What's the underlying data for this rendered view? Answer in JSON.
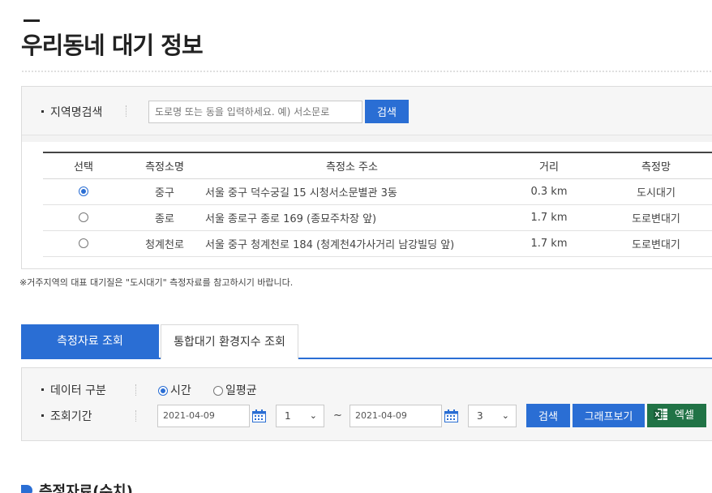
{
  "page": {
    "title": "우리동네 대기 정보"
  },
  "region_search": {
    "label": "지역명검색",
    "placeholder": "도로명 또는 동을 입력하세요. 예) 서소문로",
    "button": "검색"
  },
  "results": {
    "headers": [
      "선택",
      "측정소명",
      "측정소 주소",
      "거리",
      "측정망"
    ],
    "rows": [
      {
        "selected": true,
        "station": "중구",
        "address": "서울 중구 덕수궁길 15 시청서소문별관 3동",
        "distance": "0.3 km",
        "network": "도시대기"
      },
      {
        "selected": false,
        "station": "종로",
        "address": "서울 종로구 종로 169 (종묘주차장 앞)",
        "distance": "1.7 km",
        "network": "도로변대기"
      },
      {
        "selected": false,
        "station": "청계천로",
        "address": "서울 중구 청계천로 184 (청계천4가사거리 남강빌딩 앞)",
        "distance": "1.7 km",
        "network": "도로변대기"
      }
    ]
  },
  "notice": "※거주지역의 대표 대기질은 \"도시대기\" 측정자료를 참고하시기 바랍니다.",
  "tabs": [
    {
      "label": "측정자료 조회",
      "active": true
    },
    {
      "label": "통합대기 환경지수 조회",
      "active": false
    }
  ],
  "query": {
    "data_type_label": "데이터 구분",
    "options": [
      {
        "label": "시간",
        "checked": true
      },
      {
        "label": "일평균",
        "checked": false
      }
    ],
    "period_label": "조회기간",
    "start_date": "2021-04-09",
    "start_hour": "1",
    "tilde": "~",
    "end_date": "2021-04-09",
    "end_hour": "3",
    "search_button": "검색",
    "graph_button": "그래프보기",
    "excel_button": "엑셀"
  },
  "section": {
    "title": "측정자료(수치)"
  },
  "colors": {
    "accent": "#2a6ed4",
    "excel": "#217346"
  }
}
